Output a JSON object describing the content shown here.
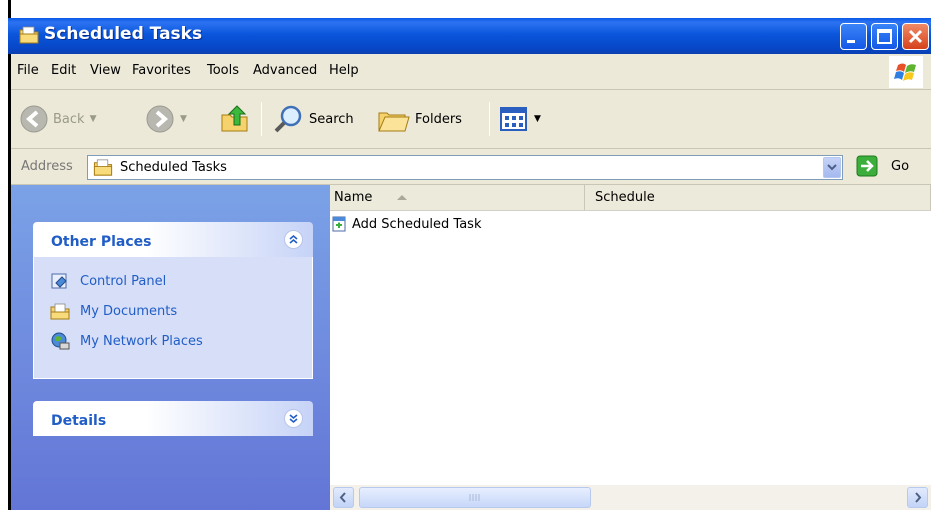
{
  "window": {
    "title": "Scheduled Tasks"
  },
  "menu": [
    "File",
    "Edit",
    "View",
    "Favorites",
    "Tools",
    "Advanced",
    "Help"
  ],
  "toolbar": {
    "back_label": "Back",
    "search_label": "Search",
    "folders_label": "Folders"
  },
  "address": {
    "label": "Address",
    "value": "Scheduled Tasks",
    "go_label": "Go"
  },
  "taskpane": {
    "other_places": {
      "title": "Other Places",
      "items": [
        {
          "label": "Control Panel",
          "icon": "control-panel-icon"
        },
        {
          "label": "My Documents",
          "icon": "my-documents-icon"
        },
        {
          "label": "My Network Places",
          "icon": "network-places-icon"
        }
      ]
    },
    "details": {
      "title": "Details"
    }
  },
  "list": {
    "columns": [
      "Name",
      "Schedule"
    ],
    "sort_column": "Name",
    "sort_direction": "ascending",
    "items": [
      {
        "name": "Add Scheduled Task",
        "icon": "add-task-icon"
      }
    ]
  },
  "colors": {
    "titlebar": "#0a56dc",
    "taskpane_top": "#7ba2e7",
    "taskpane_bottom": "#6375d6",
    "link": "#215dc6",
    "chrome": "#ece9d8"
  }
}
